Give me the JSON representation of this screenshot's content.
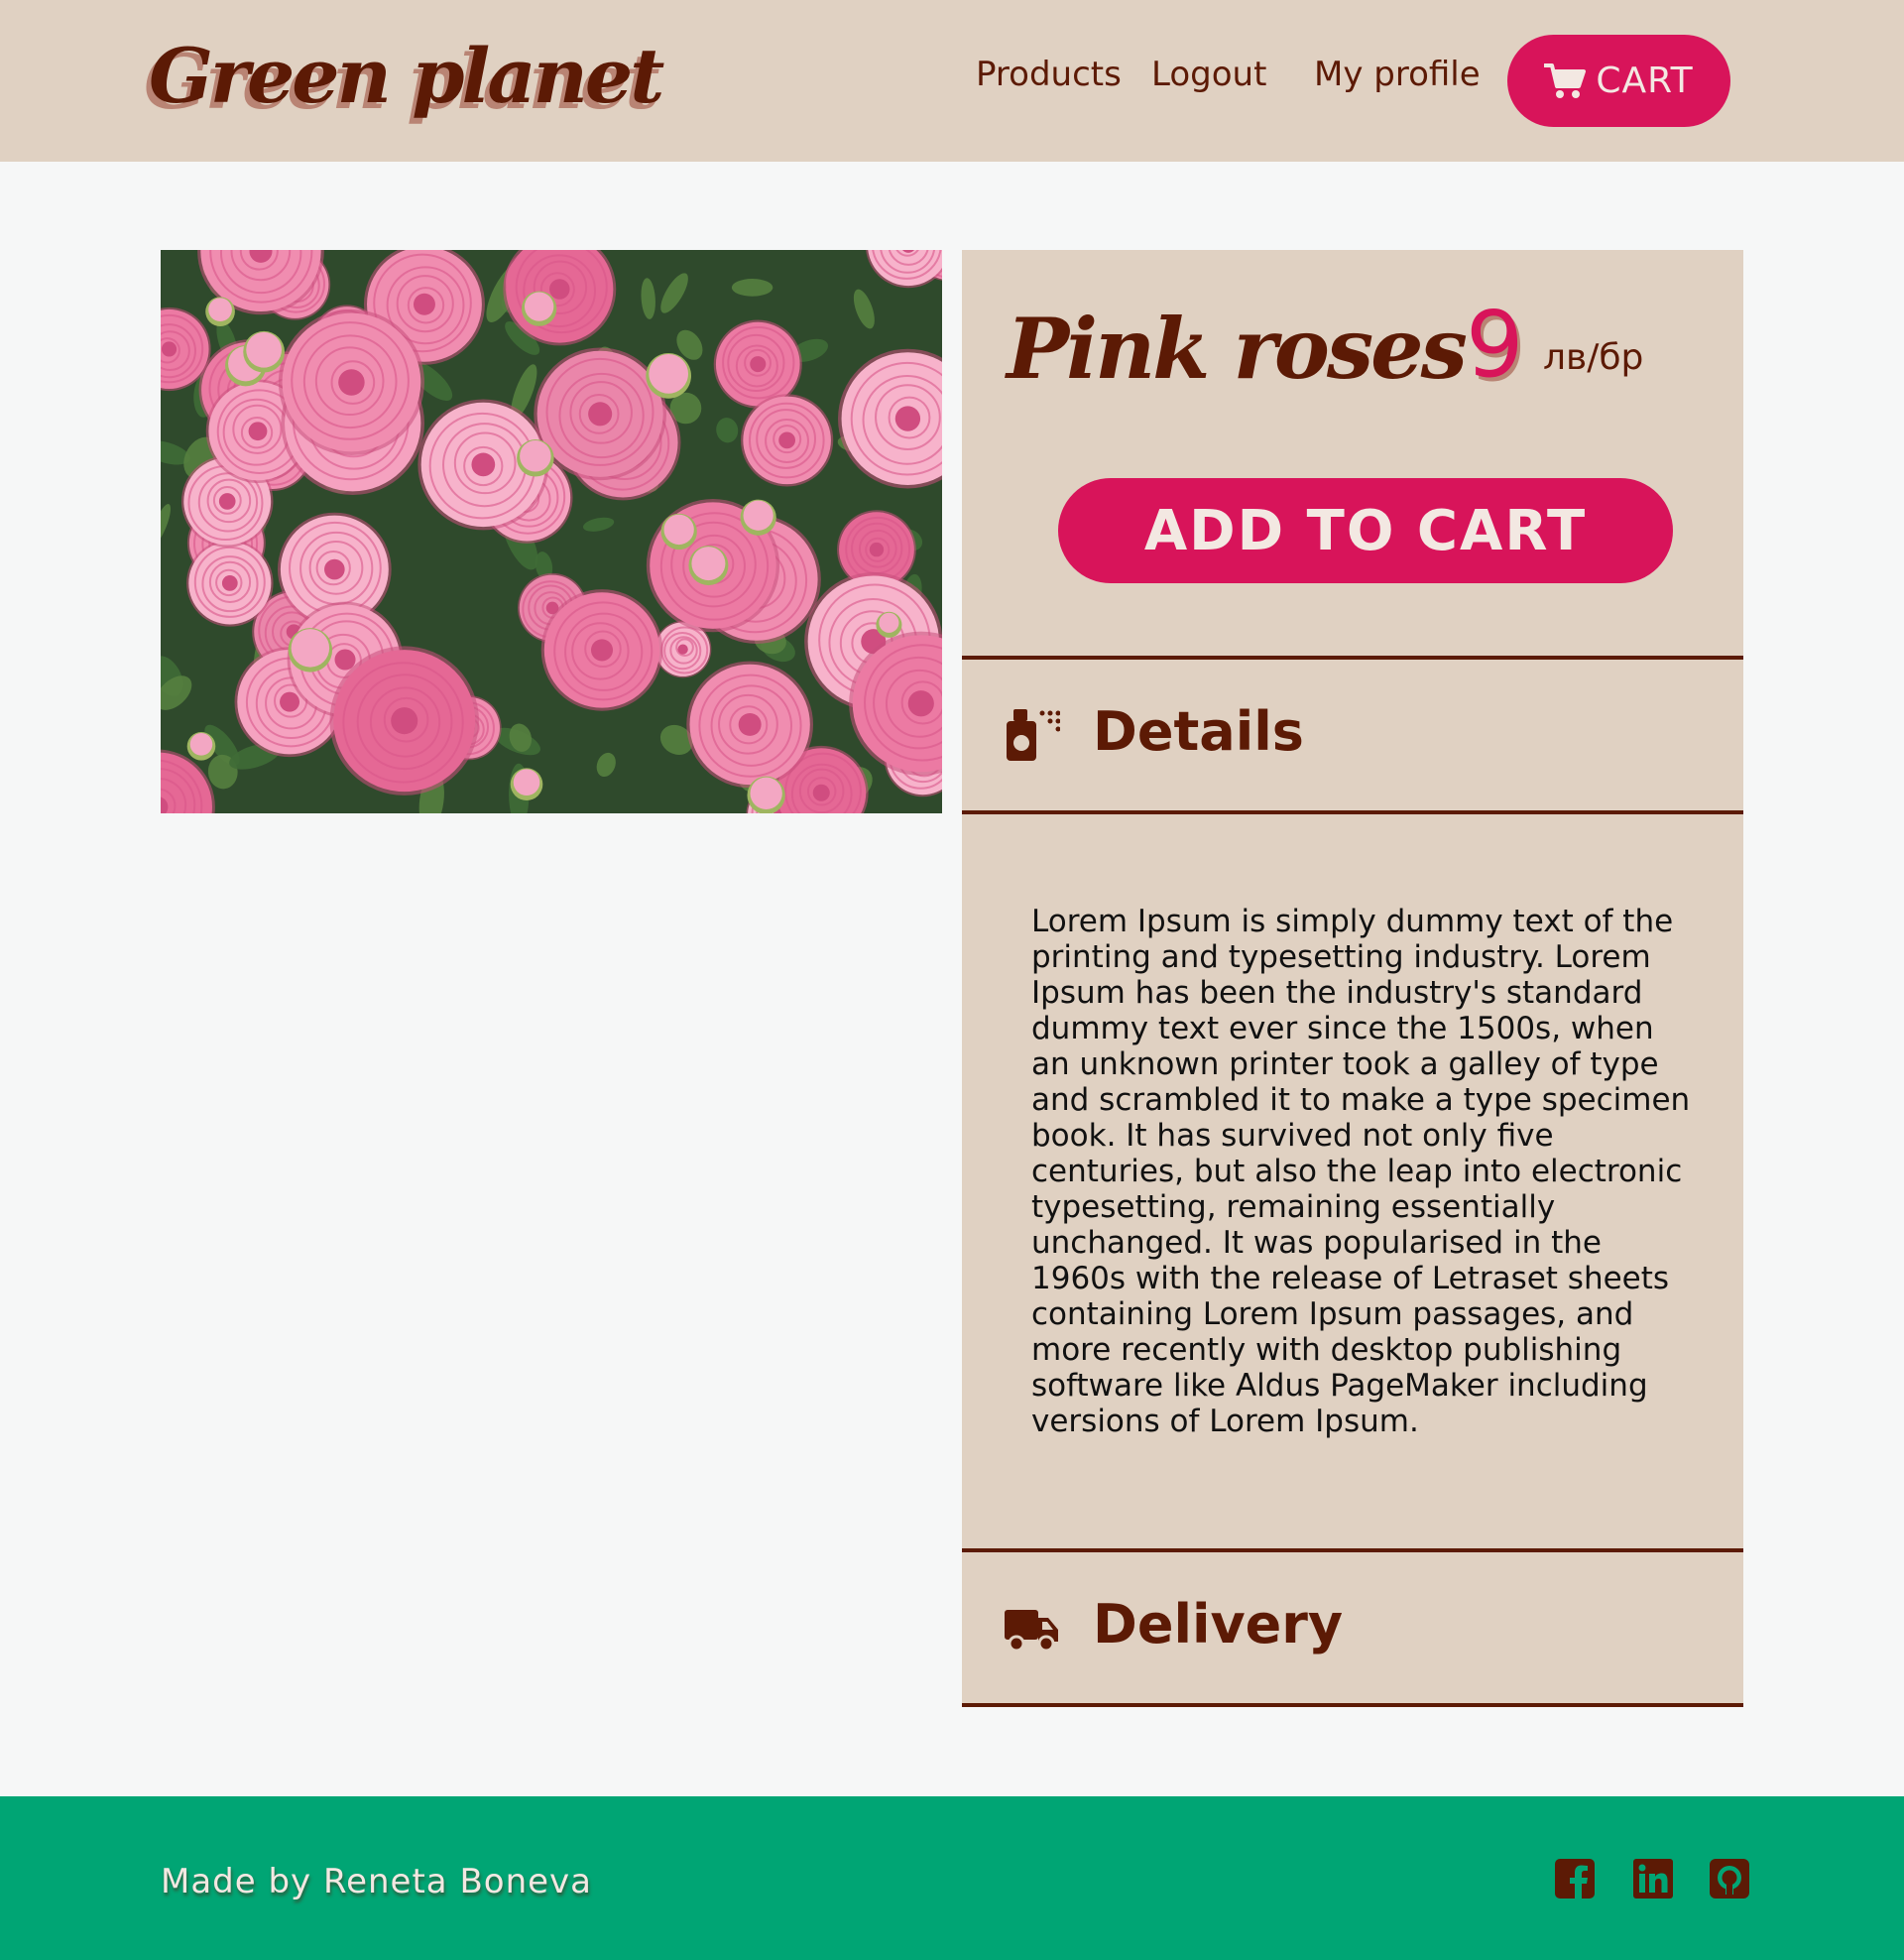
{
  "header": {
    "logo": "Green planet",
    "nav": {
      "products": "Products",
      "logout": "Logout",
      "profile": "My profile"
    },
    "cart_label": "CART"
  },
  "product": {
    "name": "Pink roses",
    "price": "9",
    "unit": "лв/бр",
    "add_to_cart": "ADD TO CART",
    "image_icon": "pink-roses-photo"
  },
  "details": {
    "title": "Details",
    "icon": "spray-bottle-icon",
    "text": "Lorem Ipsum is simply dummy text of the printing and typesetting industry. Lorem Ipsum has been the industry's standard dummy text ever since the 1500s, when an unknown printer took a galley of type and scrambled it to make a type specimen book. It has survived not only five centuries, but also the leap into electronic typesetting, remaining essentially unchanged. It was popularised in the 1960s with the release of Letraset sheets containing Lorem Ipsum passages, and more recently with desktop publishing software like Aldus PageMaker including versions of Lorem Ipsum."
  },
  "delivery": {
    "title": "Delivery",
    "icon": "truck-icon"
  },
  "footer": {
    "credit": "Made by Reneta Boneva",
    "social": [
      "facebook-icon",
      "linkedin-icon",
      "github-icon"
    ]
  },
  "colors": {
    "header_bg": "#e0d1c2",
    "accent": "#d8145a",
    "brown": "#5c1a05",
    "footer_bg": "#00a574",
    "page_bg": "#f6f7f7"
  }
}
